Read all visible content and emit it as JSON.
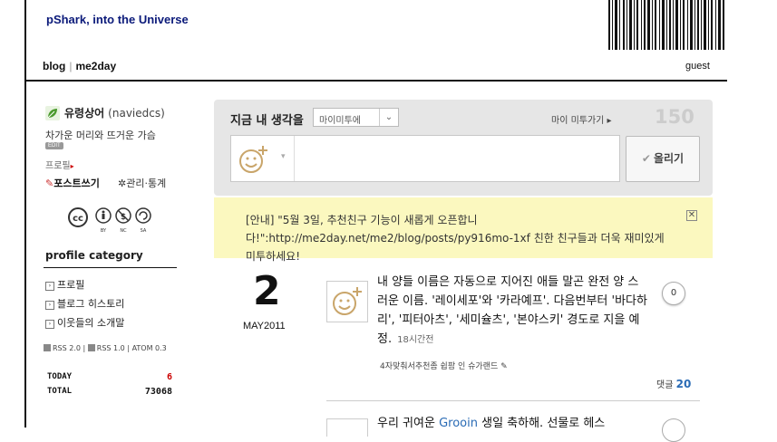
{
  "header": {
    "site_title": "pShark, into the Universe",
    "nav": [
      "blog",
      "me2day"
    ],
    "user": "guest"
  },
  "sidebar": {
    "profile_name": "유령상어",
    "profile_id": "(naviedcs)",
    "tagline": "차가운 머리와 뜨거운 가슴",
    "edit_label": "EDIT",
    "profile_link": "프로필",
    "post_link": "포스트쓰기",
    "admin_link": "관리·통계",
    "license_labels": [
      "BY",
      "NC",
      "SA"
    ],
    "category_title": "profile category",
    "categories": [
      "프로필",
      "블로그 히스토리",
      "이웃들의 소개말"
    ],
    "feeds": [
      "RSS 2.0",
      "RSS 1.0",
      "ATOM 0.3"
    ],
    "stats": [
      {
        "label": "TODAY",
        "value": "6",
        "color": "#cc0000"
      },
      {
        "label": "TOTAL",
        "value": "73068",
        "color": "#111111"
      }
    ]
  },
  "composer": {
    "label": "지금 내 생각을",
    "select_value": "마이미투에",
    "my_link": "마이 미투가기 ▸",
    "counter": "150",
    "submit": "올리기",
    "input_value": ""
  },
  "notice": {
    "text": "[안내] \"5월 3일, 추천친구 기능이 새롭게 오픈합니다!\":http://me2day.net/me2/blog/posts/py916mo-1xf 친한 친구들과 더욱 재미있게 미투하세요!",
    "close": "✕"
  },
  "entry": {
    "day": "2",
    "month_year": "MAY2011",
    "body": "내 양들 이름은 자동으로 지어진 애들 말곤 완전 양 스러운 이름. '레이세포'와 '카라예프'. 다음번부터 '바다하리', '피터아츠', '세미슐츠', '본야스키' 경도로 지을 예정.",
    "time": "18시간전",
    "tags": "4자맞춰서추천좀 쉽팜 인 슈가랜드",
    "tag_icon": "✎",
    "bubble_count": "0",
    "comment_label": "댓글",
    "comment_count": "20"
  },
  "next_entry": {
    "body_prefix": "우리 귀여운 ",
    "link": "Grooin",
    "body_suffix": " 생일 축하해. 선물로 헤스"
  }
}
